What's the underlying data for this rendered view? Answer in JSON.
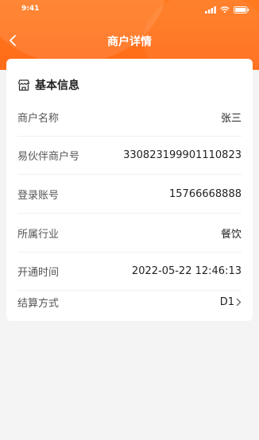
{
  "status_bar": {
    "time": "9:41"
  },
  "nav": {
    "title": "商户详情"
  },
  "section": {
    "title": "基本信息"
  },
  "rows": [
    {
      "label": "商户名称",
      "value": "张三"
    },
    {
      "label": "易伙伴商户号",
      "value": "330823199901110823"
    },
    {
      "label": "登录账号",
      "value": "15766668888"
    },
    {
      "label": "所属行业",
      "value": "餐饮"
    },
    {
      "label": "开通时间",
      "value": "2022-05-22 12:46:13"
    },
    {
      "label": "结算方式",
      "value": "D1"
    }
  ],
  "colors": {
    "accent": "#ff6a17"
  }
}
